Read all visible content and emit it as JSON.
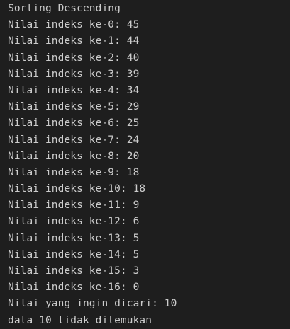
{
  "terminal": {
    "lines": [
      "Sorting Descending",
      "Nilai indeks ke-0: 45",
      "Nilai indeks ke-1: 44",
      "Nilai indeks ke-2: 40",
      "Nilai indeks ke-3: 39",
      "Nilai indeks ke-4: 34",
      "Nilai indeks ke-5: 29",
      "Nilai indeks ke-6: 25",
      "Nilai indeks ke-7: 24",
      "Nilai indeks ke-8: 20",
      "Nilai indeks ke-9: 18",
      "Nilai indeks ke-10: 18",
      "Nilai indeks ke-11: 9",
      "Nilai indeks ke-12: 6",
      "Nilai indeks ke-13: 5",
      "Nilai indeks ke-14: 5",
      "Nilai indeks ke-15: 3",
      "Nilai indeks ke-16: 0",
      "Nilai yang ingin dicari: 10",
      "data 10 tidak ditemukan"
    ]
  },
  "colors": {
    "background": "#1e1e1e",
    "text": "#cccccc"
  }
}
